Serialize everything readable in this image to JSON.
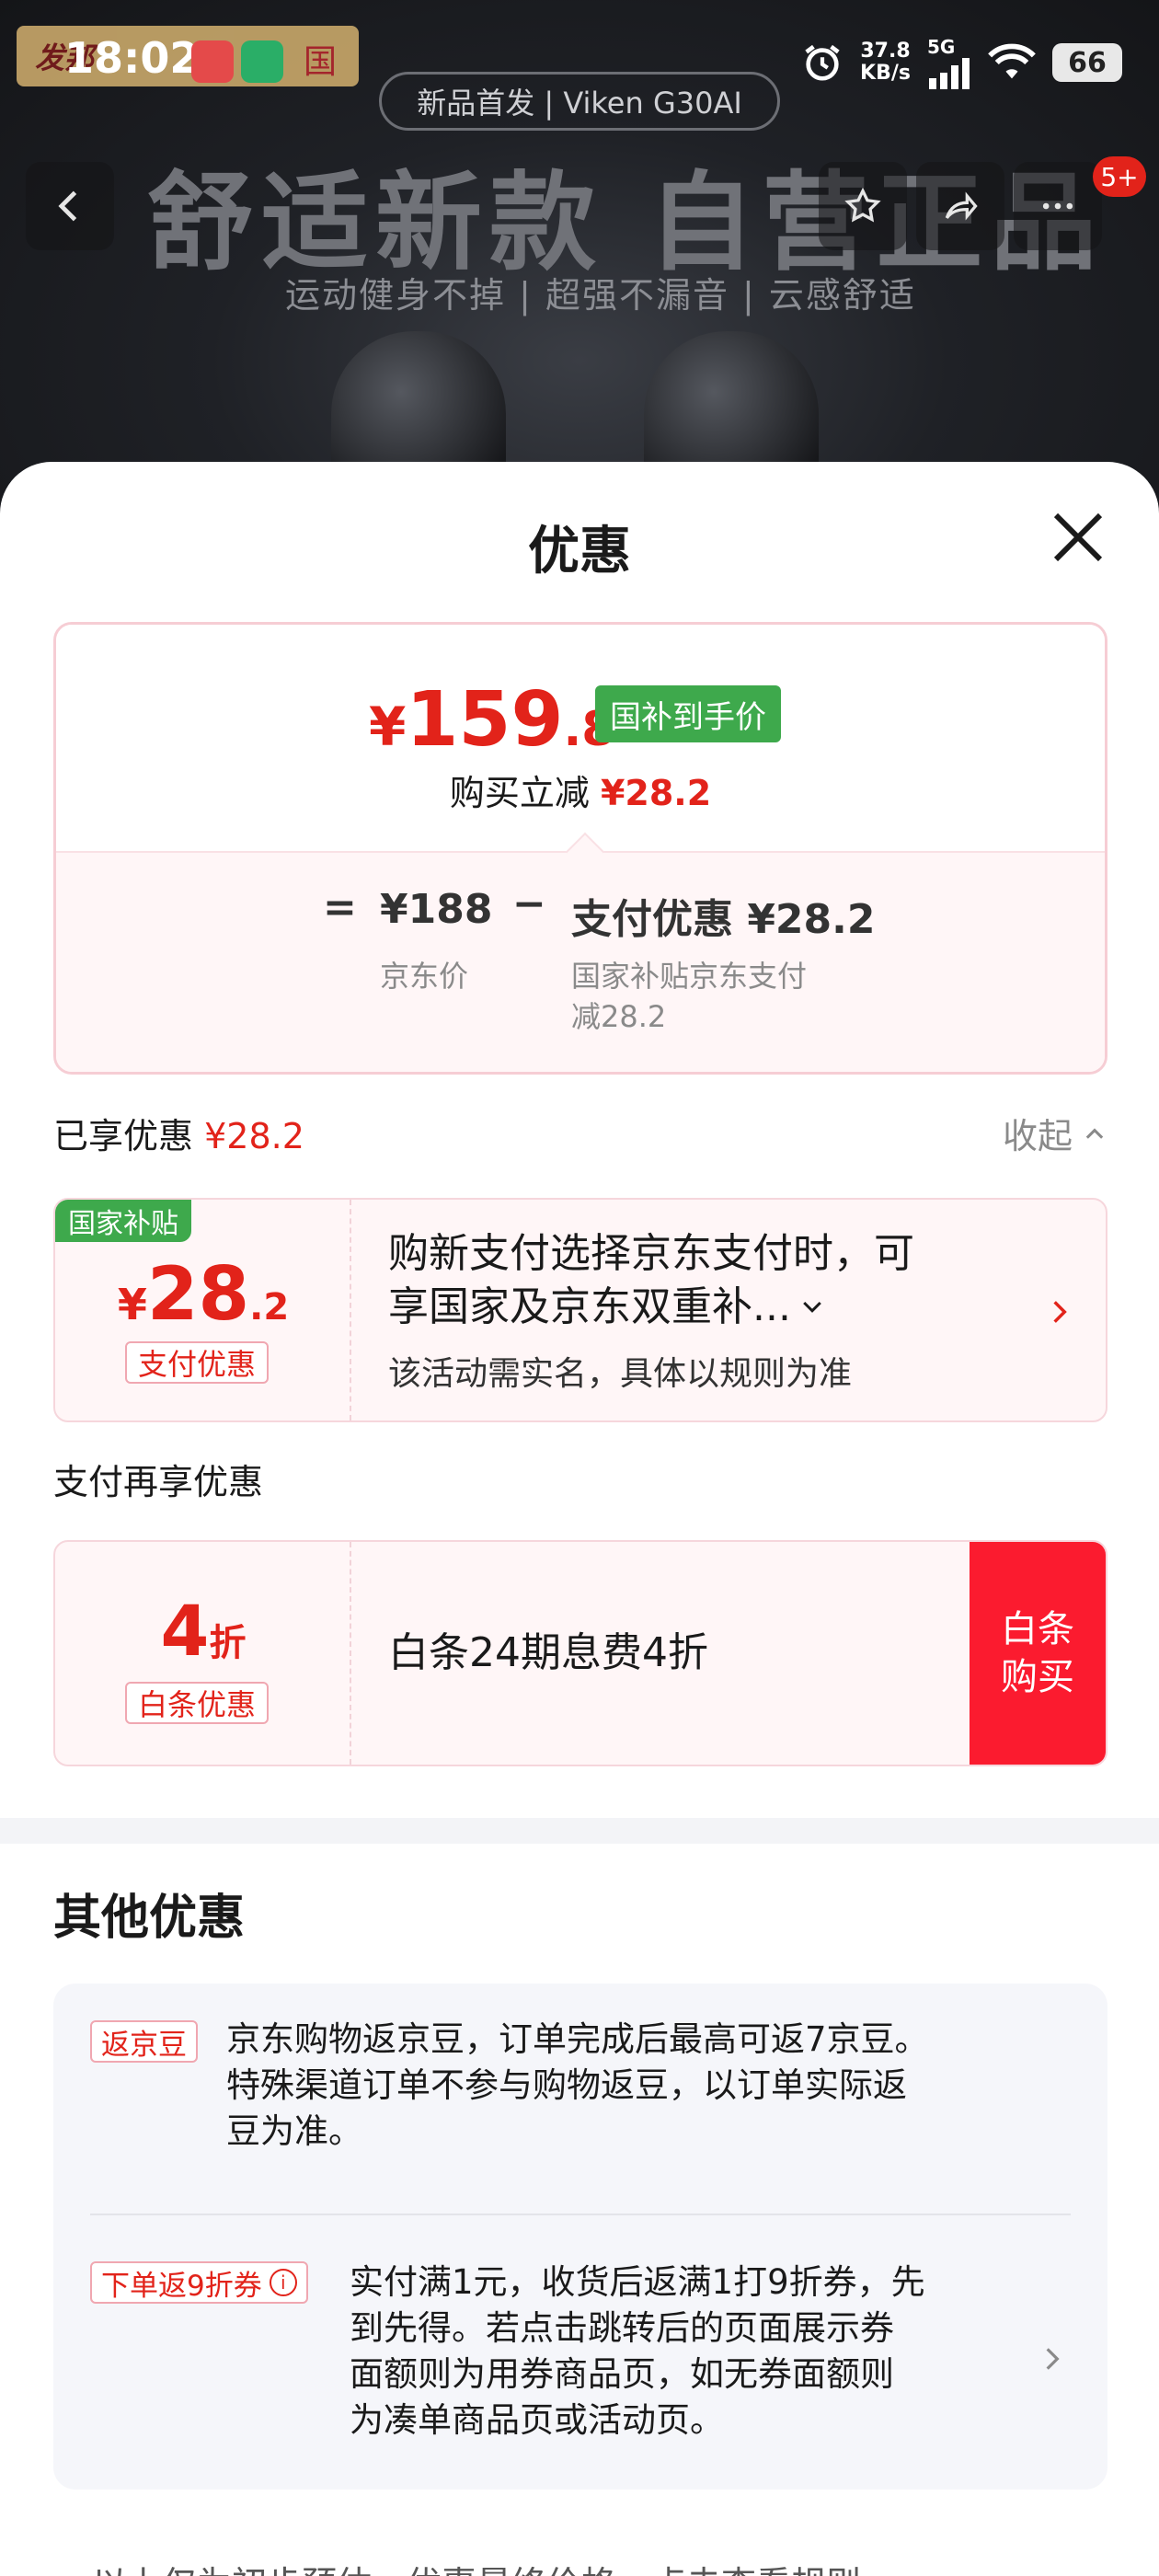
{
  "status_bar": {
    "time": "18:02",
    "net_speed_value": "37.8",
    "net_speed_unit": "KB/s",
    "network": "5G",
    "battery": "66",
    "brand_sticker_text": "发邦",
    "brand_sticker_text2": "国"
  },
  "banner": {
    "launch_pill": "新品首发 | Viken G30AI",
    "headline": "舒适新款 自营正品",
    "subline": "运动健身不掉 | 超强不漏音 | 云感舒适",
    "badge": "5+"
  },
  "sheet": {
    "title": "优惠",
    "price_card": {
      "currency": "¥",
      "price_int": "159",
      "price_dec": ".8",
      "tag": "国补到手价",
      "save_label": "购买立减",
      "save_amount": "¥28.2",
      "equals": "=",
      "jd_price": "¥188",
      "jd_price_label": "京东价",
      "minus": "−",
      "pay_discount": "支付优惠 ¥28.2",
      "pay_discount_note_1": "国家补贴京东支付",
      "pay_discount_note_2": "减28.2"
    },
    "enjoyed": {
      "label": "已享优惠",
      "amount": "¥28.2",
      "collapse": "收起"
    },
    "coupon_subsidy": {
      "corner_tag": "国家补贴",
      "currency": "¥",
      "amount_int": "28",
      "amount_dec": ".2",
      "chip": "支付优惠",
      "text_line1": "购新支付选择京东支付时，可",
      "text_line2": "享国家及京东双重补...",
      "note": "该活动需实名，具体以规则为准"
    },
    "pay_more_title": "支付再享优惠",
    "coupon_baitiao": {
      "amount": "4",
      "unit": "折",
      "chip": "白条优惠",
      "text": "白条24期息费4折",
      "button_line1": "白条",
      "button_line2": "购买"
    },
    "other": {
      "title": "其他优惠",
      "items": [
        {
          "tag": "返京豆",
          "lines": [
            "京东购物返京豆，订单完成后最高可返7京豆。",
            "特殊渠道订单不参与购物返豆，以订单实际返",
            "豆为准。"
          ]
        },
        {
          "tag": "下单返9折券",
          "lines": [
            "实付满1元，收货后返满1打9折券，先",
            "到先得。若点击跳转后的页面展示券",
            "面额则为用券商品页，如无券面额则",
            "为凑单商品页或活动页。"
          ]
        }
      ]
    },
    "footer_partial": "以上仅为初步预估，优惠最终价格，点击查看规则"
  }
}
